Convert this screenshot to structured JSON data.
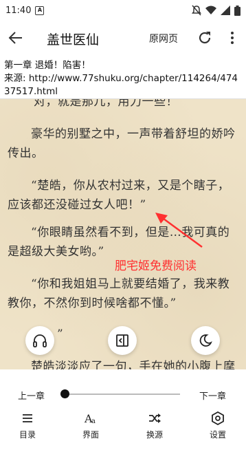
{
  "status": {
    "time": "11:40",
    "app_badge": "A"
  },
  "toolbar": {
    "title": "盖世医仙",
    "origin_label": "原网页"
  },
  "chapter": {
    "title": "第一章 退婚！陷害！",
    "source": "来源: http://www.77shuku.org/chapter/114264/47437517.html"
  },
  "content": {
    "paragraphs": [
      "对，就是那儿，用力一些！",
      "豪华的别墅之中，一声带着舒坦的娇吟传出。",
      "“楚皓，你从农村过来，又是个瞎子，应该都还没碰过女人吧！”",
      "“你眼睛虽然看不到，但是…我可真的是超级大美女哟。”",
      "“你和我姐姐马上就要结婚了，我来教教你，不然你到时候啥都不懂。”",
      "”",
      "楚皓淡淡应了一句，手在她的小腹上摩"
    ]
  },
  "annotation": {
    "text": "肥宅姬免费阅读",
    "color": "#ff3030"
  },
  "bottom": {
    "prev_label": "上一章",
    "next_label": "下一章",
    "progress": 0,
    "menu": [
      "目录",
      "界面",
      "换源",
      "设置"
    ]
  }
}
